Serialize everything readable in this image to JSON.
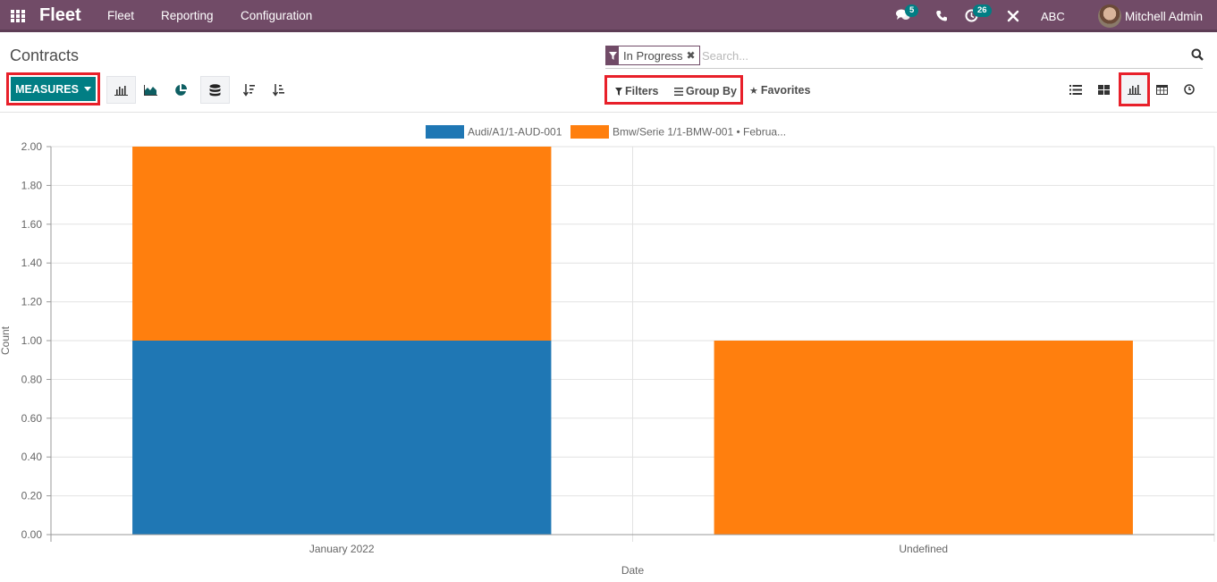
{
  "navbar": {
    "app_name": "Fleet",
    "menu": [
      "Fleet",
      "Reporting",
      "Configuration"
    ],
    "messages_badge": "5",
    "activities_badge": "26",
    "company": "ABC",
    "user": "Mitchell Admin",
    "icons": [
      "apps-grid-icon",
      "chat-icon",
      "phone-icon",
      "clock-activity-icon",
      "tools-icon"
    ]
  },
  "control_panel": {
    "title": "Contracts",
    "measures_label": "MEASURES",
    "graph_modes": [
      "bar-chart-icon",
      "line-chart-icon",
      "pie-chart-icon"
    ],
    "stacked_icon": "database-stack-icon",
    "sort_icons": [
      "sort-descending-icon",
      "sort-ascending-icon"
    ],
    "search": {
      "facet_label": "In Progress",
      "placeholder": "Search..."
    },
    "filters_label": "Filters",
    "group_by_label": "Group By",
    "favorites_label": "Favorites",
    "views": [
      "list-view-icon",
      "kanban-view-icon",
      "graph-view-icon",
      "pivot-view-icon",
      "activity-view-icon"
    ],
    "active_view": "graph"
  },
  "colors": {
    "brand": "#714b67",
    "accent": "#017e84",
    "highlight": "#e8202a",
    "series_blue": "#1f77b4",
    "series_orange": "#ff7f0e"
  },
  "chart_data": {
    "type": "bar",
    "stacked": true,
    "title": "",
    "xlabel": "Date",
    "ylabel": "Count",
    "categories": [
      "January 2022",
      "Undefined"
    ],
    "series": [
      {
        "name": "Audi/A1/1-AUD-001",
        "color": "#1f77b4",
        "values": [
          1,
          0
        ]
      },
      {
        "name": "Bmw/Serie 1/1-BMW-001 • Februa...",
        "color": "#ff7f0e",
        "values": [
          1,
          1
        ]
      }
    ],
    "ylim": [
      0,
      2
    ],
    "yticks": [
      "0.00",
      "0.20",
      "0.40",
      "0.60",
      "0.80",
      "1.00",
      "1.20",
      "1.40",
      "1.60",
      "1.80",
      "2.00"
    ],
    "grid": true,
    "legend": "top-center"
  }
}
